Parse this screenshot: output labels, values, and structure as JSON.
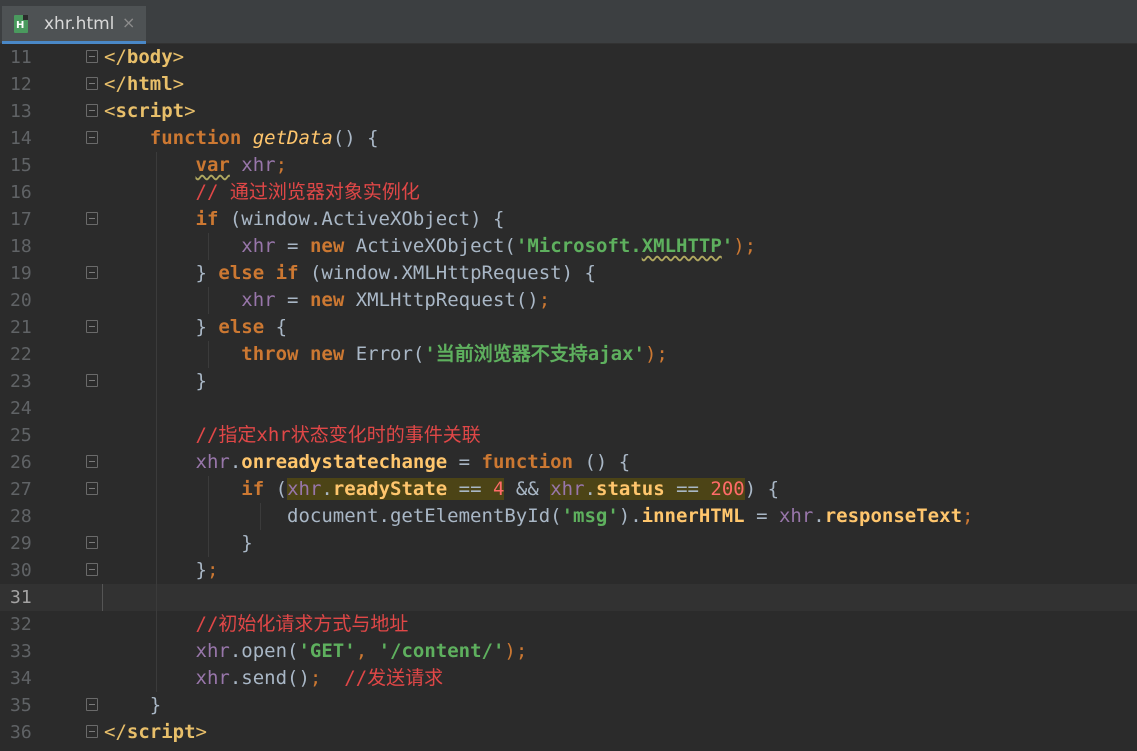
{
  "tab": {
    "label": "xhr.html",
    "close": "×",
    "icon_glyph": "H"
  },
  "lines": [
    {
      "no": "11"
    },
    {
      "no": "12"
    },
    {
      "no": "13"
    },
    {
      "no": "14"
    },
    {
      "no": "15"
    },
    {
      "no": "16"
    },
    {
      "no": "17"
    },
    {
      "no": "18"
    },
    {
      "no": "19"
    },
    {
      "no": "20"
    },
    {
      "no": "21"
    },
    {
      "no": "22"
    },
    {
      "no": "23"
    },
    {
      "no": "24"
    },
    {
      "no": "25"
    },
    {
      "no": "26"
    },
    {
      "no": "27"
    },
    {
      "no": "28"
    },
    {
      "no": "29"
    },
    {
      "no": "30"
    },
    {
      "no": "31"
    },
    {
      "no": "32"
    },
    {
      "no": "33"
    },
    {
      "no": "34"
    },
    {
      "no": "35"
    },
    {
      "no": "36"
    }
  ],
  "code": {
    "l11": {
      "open": "</",
      "tag": "body",
      "close": ">"
    },
    "l12": {
      "open": "</",
      "tag": "html",
      "close": ">"
    },
    "l13": {
      "open": "<",
      "tag": "script",
      "close": ">"
    },
    "l14": {
      "kw": "function",
      "name": "getData",
      "rest": "() {"
    },
    "l15": {
      "kw": "var",
      "name": "xhr",
      "semi": ";"
    },
    "l16": {
      "comment": "// 通过浏览器对象实例化"
    },
    "l17": {
      "kw": "if",
      "rest": " (window.ActiveXObject) {"
    },
    "l18": {
      "var": "xhr",
      "eq": " = ",
      "kw": "new",
      "cls": " ActiveXObject(",
      "str_q1": "'",
      "str_a": "Microsoft.",
      "str_b": "XMLHTTP",
      "str_q2": "'",
      "end": ");"
    },
    "l19": {
      "b1": "} ",
      "kw1": "else",
      "sp": " ",
      "kw2": "if",
      "rest": " (window.XMLHttpRequest) {"
    },
    "l20": {
      "var": "xhr",
      "eq": " = ",
      "kw": "new",
      "cls": " XMLHttpRequest()",
      "end": ";"
    },
    "l21": {
      "b1": "} ",
      "kw": "else",
      "rest": " {"
    },
    "l22": {
      "kw1": "throw",
      "sp": " ",
      "kw2": "new",
      "cls": " Error(",
      "str": "'当前浏览器不支持ajax'",
      "end": ");"
    },
    "l23": {
      "rest": "}"
    },
    "l25": {
      "comment": "//指定xhr状态变化时的事件关联"
    },
    "l26": {
      "var": "xhr",
      "dot": ".",
      "prop": "onreadystatechange",
      "eq": " = ",
      "kw": "function",
      "rest": " () {"
    },
    "l27": {
      "kw": "if",
      "p1": " (",
      "var1": "xhr",
      "dot1": ".",
      "prop1": "readyState",
      "op1": " == ",
      "num1": "4",
      "and": " && ",
      "var2": "xhr",
      "dot2": ".",
      "prop2": "status",
      "op2": " == ",
      "num2": "200",
      "end": ") {"
    },
    "l28": {
      "a": "document.getElementById(",
      "str": "'msg'",
      "b": ").",
      "prop1": "innerHTML",
      "eq": " = ",
      "var": "xhr",
      "dot": ".",
      "prop2": "responseText",
      "end": ";"
    },
    "l29": {
      "rest": "}"
    },
    "l30": {
      "rest": "}",
      "semi": ";"
    },
    "l32": {
      "comment": "//初始化请求方式与地址"
    },
    "l33": {
      "var": "xhr",
      "a": ".open(",
      "str1": "'GET'",
      "c": ", ",
      "str2": "'/content/'",
      "end": ");"
    },
    "l34": {
      "var": "xhr",
      "a": ".send()",
      "semi": ";",
      "sp": "  ",
      "comment": "//发送请求"
    },
    "l35": {
      "rest": "}"
    },
    "l36": {
      "open": "</",
      "tag": "script",
      "close": ">"
    }
  }
}
